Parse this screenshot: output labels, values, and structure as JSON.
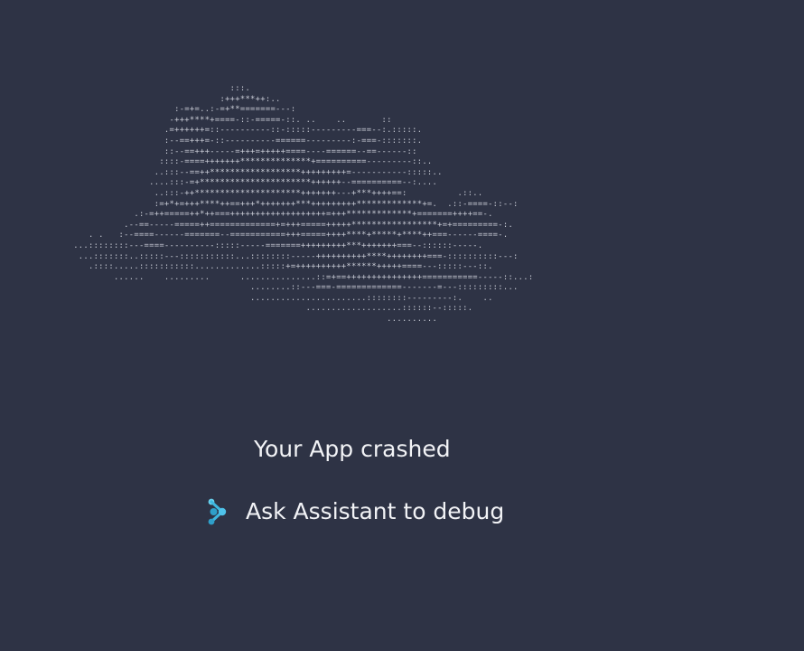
{
  "ascii_cloud": [
    "                                 :::.",
    "                               :+++***++:..",
    "                      :-=+=..:-=+**=======---:",
    "                     -+++****+====-::-=====-::. ..    ..       ::",
    "                    .=++++++=::----------::-:::::---------===--:.:::::.",
    "                    :--==+++=-::----------======---------:-===-:::::::.",
    "                    ::--==+++-----=+++=+++++====----======--==------::",
    "                   ::::-====+++++++**************+==========---------::..",
    "                  ..:::--==++******************+++++++++=-----------:::::..",
    "                 ....:::-=+**********************++++++--==========--:....",
    "                  ..:::-++*********************+++++++---+***++++==:          .::..",
    "                  :=+*+=+++****++==+++*+++++++***+++++++++*************+=.  .::-====-::--:",
    "              .:-=++=====++*++===+++++++++++++++++++=+++*************+=======++++==-.",
    "            .--==-----=====++=============+=+++=====+++++*****************+=+=========-:.",
    "     . .   :--====------=======--===========+++=====++++****+*****+****++===------====-.",
    "  ...::::::::---====----------:::::-----=======+++++++++***+++++++===--::::::-----.",
    "   ...:::::::..:::::---:::::::::::...::::::::-----++++++++++****++++++++===-::::::::::---:",
    "     .::::.....:::::::::::.............:::::+=++++++++++******+++++====---:::::---::.",
    "          ......    .........      ...............::=+==+++++++++++++++===========-----::...:",
    "                                     ........::---===-=============-------=---:::::::::...",
    "                                     .......................::::::::---------:.    ..",
    "                                                ...................::::::--:::::.",
    "                                                                .........."
  ],
  "crash_message": "Your App crashed",
  "debug_button": {
    "label": "Ask Assistant to debug",
    "icon": "assistant-icon"
  },
  "colors": {
    "background": "#2e3345",
    "text": "#f2f3f6",
    "ascii": "#c9ccd6",
    "icon_light": "#6ad3f0",
    "icon_dark": "#2f9fc9"
  }
}
